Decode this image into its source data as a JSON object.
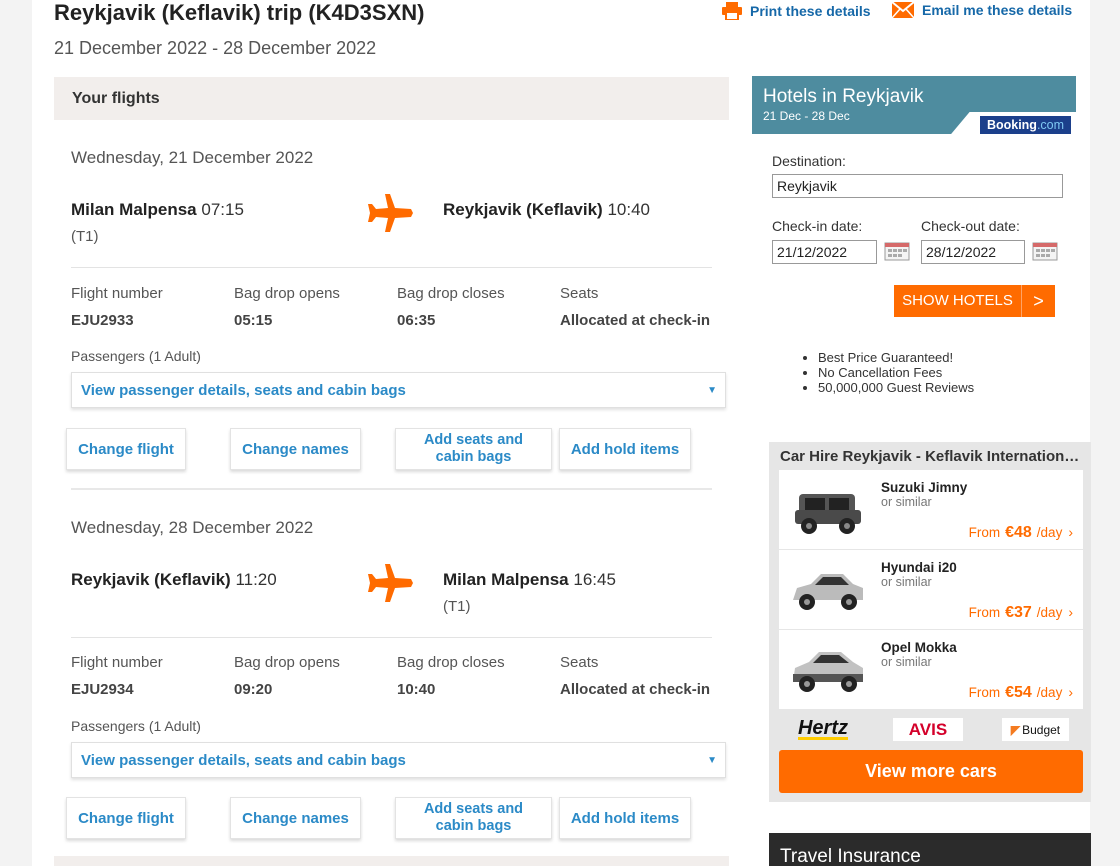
{
  "header": {
    "title": "Reykjavik (Keflavik) trip (K4D3SXN)",
    "dates": "21 December 2022 - 28 December 2022",
    "print_label": "Print these details",
    "email_label": "Email me these details"
  },
  "flights_section": {
    "title": "Your flights"
  },
  "flights": [
    {
      "date": "Wednesday, 21 December 2022",
      "from_name": "Milan Malpensa",
      "from_time": "07:15",
      "from_terminal": "(T1)",
      "to_name": "Reykjavik (Keflavik)",
      "to_time": "10:40",
      "to_terminal": "",
      "info": [
        {
          "label": "Flight number",
          "value": "EJU2933"
        },
        {
          "label": "Bag drop opens",
          "value": "05:15"
        },
        {
          "label": "Bag drop closes",
          "value": "06:35"
        },
        {
          "label": "Seats",
          "value": "Allocated at check-in"
        }
      ],
      "passengers_label": "Passengers (1 Adult)",
      "passenger_dropdown": "View passenger details, seats and cabin bags",
      "buttons": {
        "change_flight": "Change flight",
        "change_names": "Change names",
        "add_seats": "Add seats and cabin bags",
        "add_hold": "Add hold items"
      }
    },
    {
      "date": "Wednesday, 28 December 2022",
      "from_name": "Reykjavik (Keflavik)",
      "from_time": "11:20",
      "from_terminal": "",
      "to_name": "Milan Malpensa",
      "to_time": "16:45",
      "to_terminal": "(T1)",
      "info": [
        {
          "label": "Flight number",
          "value": "EJU2934"
        },
        {
          "label": "Bag drop opens",
          "value": "09:20"
        },
        {
          "label": "Bag drop closes",
          "value": "10:40"
        },
        {
          "label": "Seats",
          "value": "Allocated at check-in"
        }
      ],
      "passengers_label": "Passengers (1 Adult)",
      "passenger_dropdown": "View passenger details, seats and cabin bags",
      "buttons": {
        "change_flight": "Change flight",
        "change_names": "Change names",
        "add_seats": "Add seats and cabin bags",
        "add_hold": "Add hold items"
      }
    }
  ],
  "hotels": {
    "title": "Hotels in Reykjavik",
    "dates": "21 Dec - 28 Dec",
    "brand_main": "Booking",
    "brand_suffix": ".com",
    "destination_label": "Destination:",
    "destination_value": "Reykjavik",
    "checkin_label": "Check-in date:",
    "checkin_value": "21/12/2022",
    "checkout_label": "Check-out date:",
    "checkout_value": "28/12/2022",
    "button_label": "SHOW HOTELS",
    "button_arrow": ">",
    "perks": [
      "Best Price Guaranteed!",
      "No Cancellation Fees",
      "50,000,000 Guest Reviews"
    ]
  },
  "car_hire": {
    "title": "Car Hire Reykjavik - Keflavik International Airport",
    "similar_label": "or similar",
    "from_label": "From",
    "per_day": "/day",
    "cars": [
      {
        "name": "Suzuki Jimny",
        "price": "€48",
        "color": "#555555"
      },
      {
        "name": "Hyundai i20",
        "price": "€37",
        "color": "#b9b9b9"
      },
      {
        "name": "Opel Mokka",
        "price": "€54",
        "color": "#bdbdbd"
      }
    ],
    "brands": [
      "Hertz",
      "AVIS",
      "Budget"
    ],
    "view_more": "View more cars"
  },
  "insurance": {
    "title": "Travel Insurance"
  },
  "colors": {
    "accent": "#ff6b00",
    "link": "#2b8ac7",
    "hotel_header": "#4e8c9f",
    "booking_blue": "#1b3f8b"
  }
}
